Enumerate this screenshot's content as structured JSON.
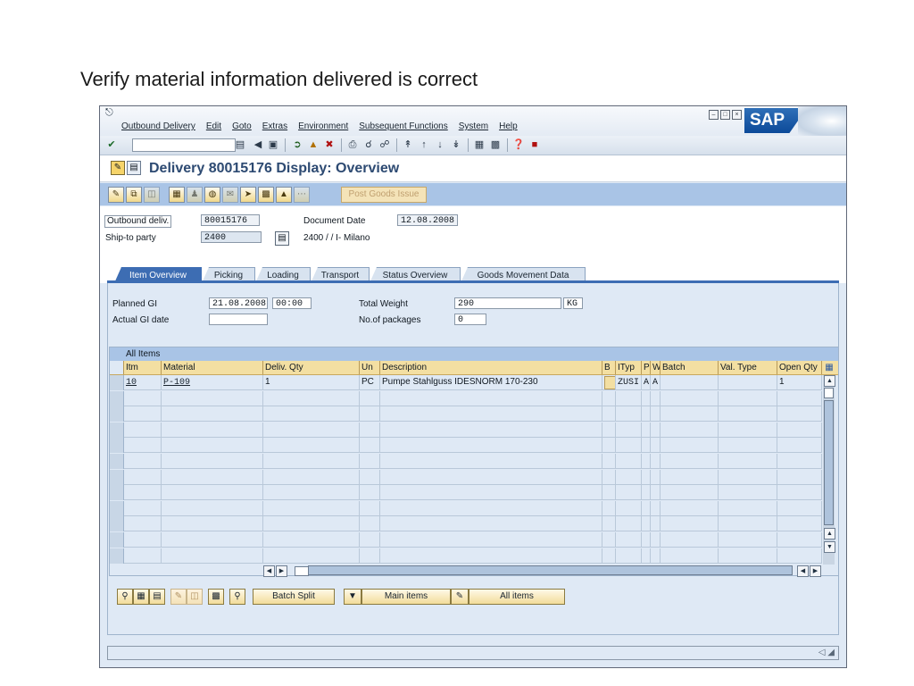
{
  "slide": {
    "title": "Verify material information delivered is correct"
  },
  "window": {
    "logo": "SAP",
    "menu": [
      "Outbound Delivery",
      "Edit",
      "Goto",
      "Extras",
      "Environment",
      "Subsequent Functions",
      "System",
      "Help"
    ],
    "command_field": {
      "value": ""
    }
  },
  "screen": {
    "title": "Delivery 80015176 Display: Overview"
  },
  "app_toolbar": {
    "post_goods_issue_label": "Post Goods Issue"
  },
  "header": {
    "outbound_deliv_label": "Outbound deliv.",
    "outbound_deliv_value": "80015176",
    "document_date_label": "Document Date",
    "document_date_value": "12.08.2008",
    "ship_to_label": "Ship-to party",
    "ship_to_value": "2400",
    "ship_to_desc": "2400 / / I- Milano"
  },
  "tabs": [
    {
      "label": "Item Overview",
      "active": true
    },
    {
      "label": "Picking",
      "active": false
    },
    {
      "label": "Loading",
      "active": false
    },
    {
      "label": "Transport",
      "active": false
    },
    {
      "label": "Status Overview",
      "active": false
    },
    {
      "label": "Goods Movement Data",
      "active": false
    }
  ],
  "overview": {
    "planned_gi_label": "Planned GI",
    "planned_gi_date": "21.08.2008",
    "planned_gi_time": "00:00",
    "actual_gi_label": "Actual GI date",
    "actual_gi_value": "",
    "total_weight_label": "Total Weight",
    "total_weight_value": "290",
    "total_weight_unit": "KG",
    "packages_label": "No.of packages",
    "packages_value": "0"
  },
  "table": {
    "title": "All Items",
    "columns": [
      "Itm",
      "Material",
      "Deliv. Qty",
      "Un",
      "Description",
      "B",
      "ITyp",
      "P",
      "W",
      "Batch",
      "Val. Type",
      "Open Qty"
    ],
    "rows": [
      {
        "itm": "10",
        "material": "P-109",
        "qty": "1",
        "un": "PC",
        "description": "Pumpe Stahlguss IDESNORM 170-230",
        "b": "",
        "ityp": "ZUSI",
        "p": "A",
        "w": "A",
        "batch": "",
        "val_type": "",
        "open_qty": "1"
      }
    ]
  },
  "bottom_buttons": {
    "batch_split": "Batch Split",
    "main_items": "Main items",
    "all_items": "All items"
  }
}
